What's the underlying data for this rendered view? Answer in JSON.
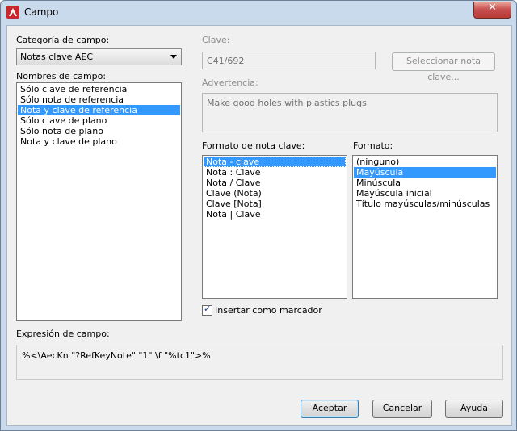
{
  "window": {
    "title": "Campo",
    "close_label": "✕"
  },
  "categoria": {
    "label": "Categoría de campo:",
    "selected": "Notas clave AEC"
  },
  "nombres": {
    "label": "Nombres de campo:",
    "items": [
      "Sólo clave de referencia",
      "Sólo nota de referencia",
      "Nota y clave de referencia",
      "Sólo clave de plano",
      "Sólo nota de plano",
      "Nota y clave de plano"
    ],
    "selected_index": 2
  },
  "clave": {
    "label": "Clave:",
    "value": "C41/692",
    "select_button": "Seleccionar nota clave..."
  },
  "advertencia": {
    "label": "Advertencia:",
    "value": "Make good holes with plastics plugs"
  },
  "formato_nota": {
    "label": "Formato de nota clave:",
    "items": [
      "Nota - clave",
      "Nota : Clave",
      "Nota / Clave",
      "Clave (Nota)",
      "Clave [Nota]",
      "Nota | Clave"
    ],
    "selected_index": 0
  },
  "formato": {
    "label": "Formato:",
    "items": [
      "(ninguno)",
      "Mayúscula",
      "Minúscula",
      "Mayúscula inicial",
      "Título mayúsculas/minúsculas"
    ],
    "selected_index": 1
  },
  "insertar": {
    "label": "Insertar como marcador",
    "checked": true
  },
  "expresion": {
    "label": "Expresión de campo:",
    "value": "%<\\AecKn \"?RefKeyNote\" \"1\" \\f \"%tc1\">%"
  },
  "buttons": {
    "accept": "Aceptar",
    "cancel": "Cancelar",
    "help": "Ayuda"
  },
  "colors": {
    "selection": "#3399ff",
    "title_bg": "#c9daed",
    "close": "#c75050",
    "app_icon": "#c8282d"
  },
  "icons": {
    "app": "autocad-logo-icon",
    "close": "close-icon",
    "dropdown": "chevron-down-icon",
    "check": "checkmark-icon"
  }
}
